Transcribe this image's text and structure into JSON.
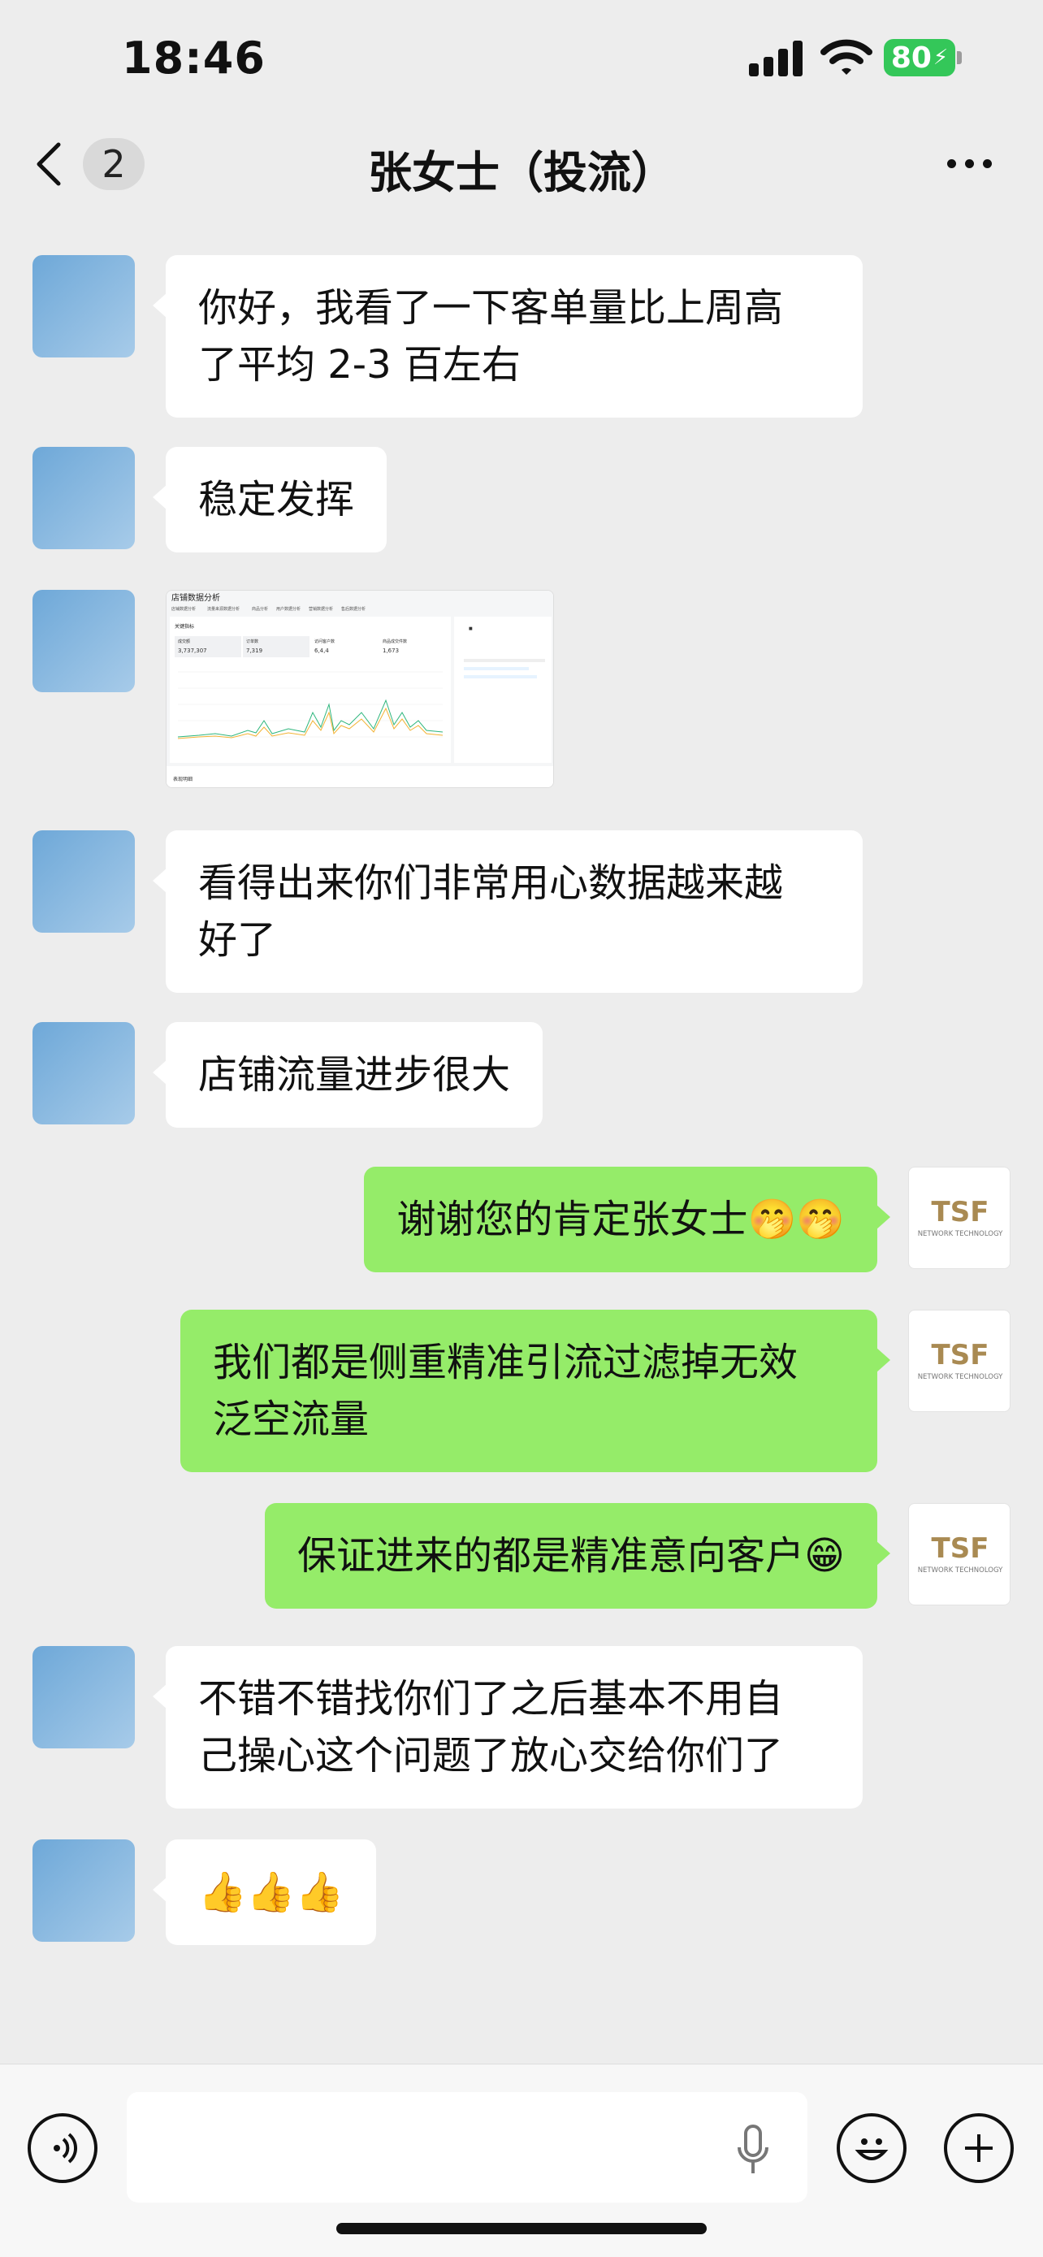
{
  "status_bar": {
    "time": "18:46",
    "battery": "80"
  },
  "nav": {
    "back_badge": "2",
    "title": "张女士（投流）"
  },
  "image_thumb": {
    "title": "店铺数据分析",
    "tabs": [
      "店铺数据分析",
      "流量来源数据分析",
      "商品分析",
      "用户数据分析",
      "营销数据分析",
      "售后数据分析"
    ],
    "section": "关键指标",
    "metrics": [
      {
        "label": "成交额",
        "value": "3,737,307"
      },
      {
        "label": "订单数",
        "value": "7,319"
      },
      {
        "label": "访问客户数",
        "value": "6,4,4"
      },
      {
        "label": "商品成交件数",
        "value": "1,673"
      }
    ],
    "footer_label": "表现明细"
  },
  "messages": [
    {
      "side": "left",
      "text": "你好，我看了一下客单量比上周高\n了平均 2-3 百左右"
    },
    {
      "side": "left",
      "text": "稳定发挥"
    },
    {
      "side": "left",
      "type": "image"
    },
    {
      "side": "left",
      "text": "看得出来你们非常用心数据越来越\n好了"
    },
    {
      "side": "left",
      "text": "店铺流量进步很大"
    },
    {
      "side": "right",
      "text": "谢谢您的肯定张女士🤭🤭"
    },
    {
      "side": "right",
      "text": "我们都是侧重精准引流过滤掉无效\n泛空流量"
    },
    {
      "side": "right",
      "text": "保证进来的都是精准意向客户😁"
    },
    {
      "side": "left",
      "text": "不错不错找你们了之后基本不用自\n己操心这个问题了放心交给你们了"
    },
    {
      "side": "left",
      "text": "👍👍👍"
    }
  ],
  "right_avatar": {
    "logo": "TSF",
    "tagline": "NETWORK TECHNOLOGY"
  },
  "colors": {
    "bubble_right": "#95ec69",
    "bubble_left": "#ffffff",
    "background": "#ededed",
    "battery": "#34c759"
  },
  "icons": [
    "back-icon",
    "more-icon",
    "voice-icon",
    "mic-icon",
    "emoji-icon",
    "plus-icon"
  ]
}
